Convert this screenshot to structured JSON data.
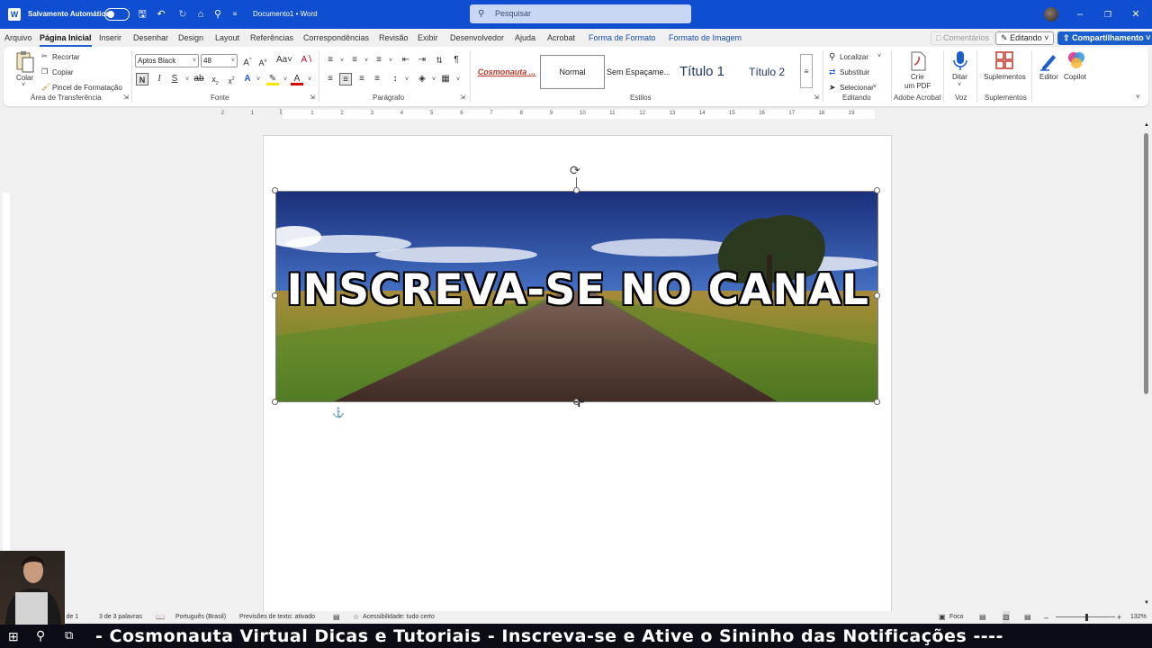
{
  "titlebar": {
    "autosave_label": "Salvamento Automático",
    "document_title": "Documento1 • Word",
    "search_placeholder": "Pesquisar"
  },
  "menu": {
    "tabs": [
      "Arquivo",
      "Página Inicial",
      "Inserir",
      "Desenhar",
      "Design",
      "Layout",
      "Referências",
      "Correspondências",
      "Revisão",
      "Exibir",
      "Desenvolvedor",
      "Ajuda",
      "Acrobat",
      "Forma de Formato",
      "Formato de Imagem"
    ],
    "active_tab": "Página Inicial",
    "comments_label": "Comentários",
    "editing_label": "Editando",
    "share_label": "Compartilhamento"
  },
  "ribbon": {
    "clipboard": {
      "paste": "Colar",
      "cut": "Recortar",
      "copy": "Copiar",
      "format_painter": "Pincel de Formatação",
      "group": "Área de Transferência"
    },
    "font": {
      "name": "Aptos Black",
      "size": "48",
      "bold": "N",
      "italic": "I",
      "underline": "S",
      "group": "Fonte"
    },
    "paragraph": {
      "group": "Parágrafo"
    },
    "styles": {
      "items": [
        "Cosmonauta ...",
        "Normal",
        "Sem Espaçame...",
        "Título 1",
        "Título 2"
      ],
      "group": "Estilos"
    },
    "editing": {
      "find": "Localizar",
      "replace": "Substituir",
      "select": "Selecionar",
      "group": "Editando"
    },
    "acrobat": {
      "create_pdf_line1": "Crie",
      "create_pdf_line2": "um PDF",
      "group": "Adobe Acrobat"
    },
    "voice": {
      "dictate": "Ditar",
      "group": "Voz"
    },
    "addins": {
      "label": "Suplementos",
      "group": "Suplementos"
    },
    "editor": {
      "label": "Editor"
    },
    "copilot": {
      "label": "Copilot"
    }
  },
  "ruler": {
    "marks": [
      "2",
      "1",
      "1",
      "2",
      "3",
      "4",
      "5",
      "6",
      "7",
      "8",
      "9",
      "10",
      "11",
      "12",
      "13",
      "14",
      "15",
      "16",
      "17",
      "18",
      "19"
    ]
  },
  "document": {
    "image_text": "INSCREVA-SE NO CANAL"
  },
  "statusbar": {
    "page": "Página 1 de 1",
    "words": "3 de 3 palavras",
    "language": "Português (Brasil)",
    "predictions": "Previsões de texto: ativado",
    "accessibility": "Acessibilidade: tudo certo",
    "focus": "Foco",
    "zoom": "132%"
  },
  "ticker": "- Cosmonauta Virtual Dicas e Tutoriais - Inscreva-se e Ative o Sininho das Notificações ----",
  "colors": {
    "titlebar": "#0f4ed1",
    "accent": "#1b5fcf",
    "taskbar": "#0c0c16"
  }
}
